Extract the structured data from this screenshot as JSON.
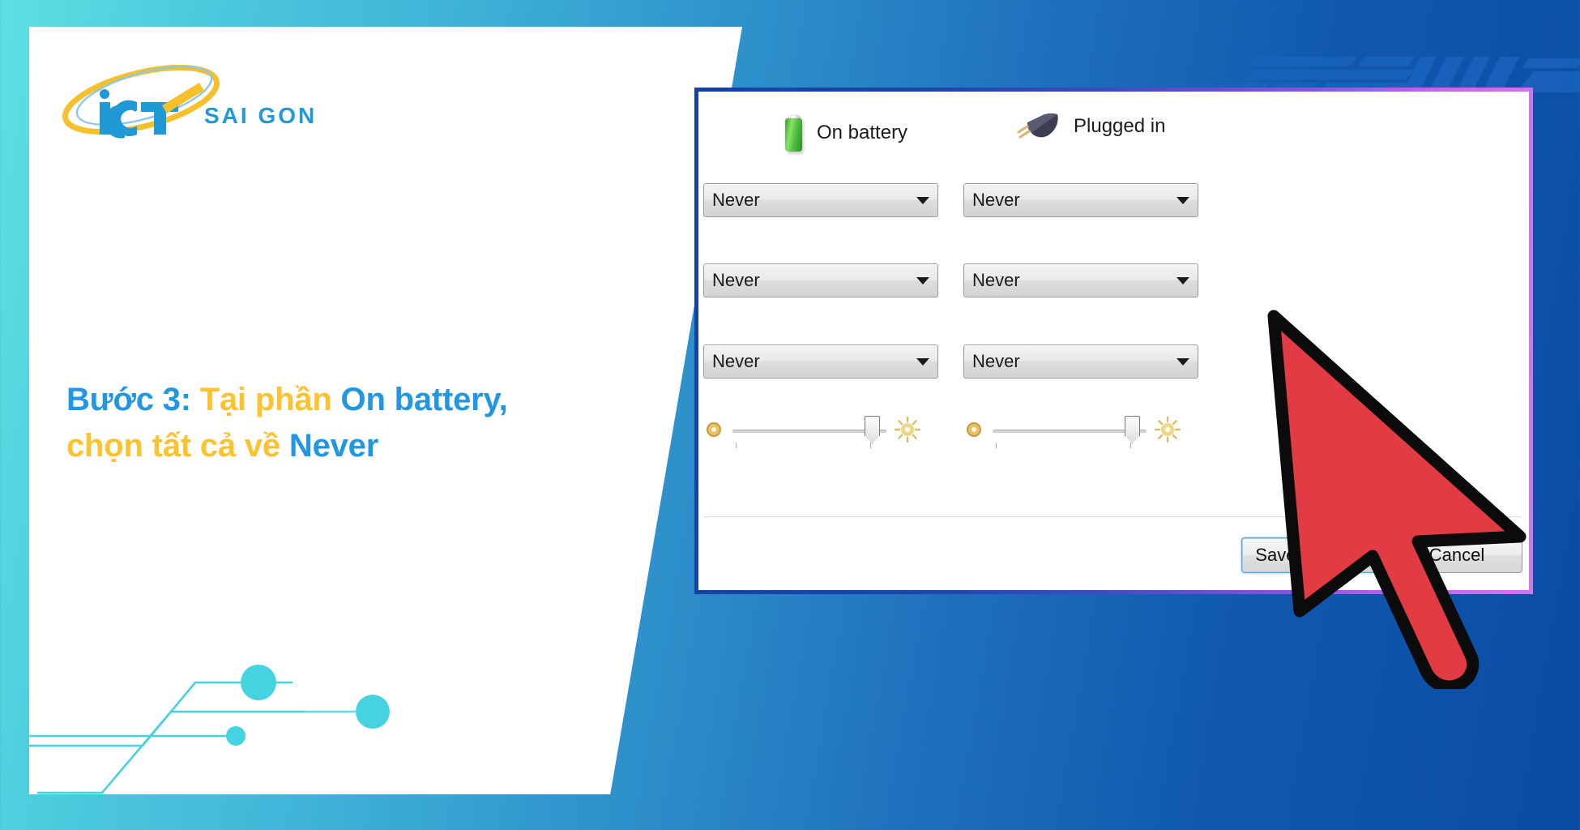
{
  "page": {
    "background_gradient_from": "#5fdfe2",
    "background_gradient_to": "#0a4ba4"
  },
  "brand": {
    "name_primary": "iCT",
    "name_secondary": "SAI GON",
    "primary_color": "#1f9ad6",
    "accent_color": "#f5c02a"
  },
  "headline": {
    "line1_part1": "Bước 3:",
    "line1_part2": "Tại phần",
    "line1_part3": "On battery,",
    "line2_part1": "chọn tất cả về",
    "line2_part2": "Never",
    "blue": "#2196e3",
    "yellow": "#fdc22d"
  },
  "dialog": {
    "border_gradient_from": "#1642a6",
    "border_gradient_to": "#cf76f0",
    "columns": [
      {
        "label": "On battery",
        "icon": "battery-icon"
      },
      {
        "label": "Plugged in",
        "icon": "power-plug-icon"
      }
    ],
    "rows": [
      {
        "on_battery": {
          "value": "Never",
          "icon": "chevron-down-icon"
        },
        "plugged_in": {
          "value": "Never",
          "icon": "chevron-down-icon"
        }
      },
      {
        "on_battery": {
          "value": "Never",
          "icon": "chevron-down-icon"
        },
        "plugged_in": {
          "value": "Never",
          "icon": "chevron-down-icon"
        }
      },
      {
        "on_battery": {
          "value": "Never",
          "icon": "chevron-down-icon"
        },
        "plugged_in": {
          "value": "Never",
          "icon": "chevron-down-icon"
        }
      }
    ],
    "brightness": {
      "low_icon": "dim-brightness-icon",
      "high_icon": "bright-brightness-icon",
      "on_battery_percent": 86,
      "plugged_in_percent": 86
    },
    "buttons": {
      "save": "Save changes",
      "cancel": "Cancel"
    }
  },
  "cursor": {
    "icon": "mouse-pointer-icon",
    "color": "#e23b44"
  }
}
